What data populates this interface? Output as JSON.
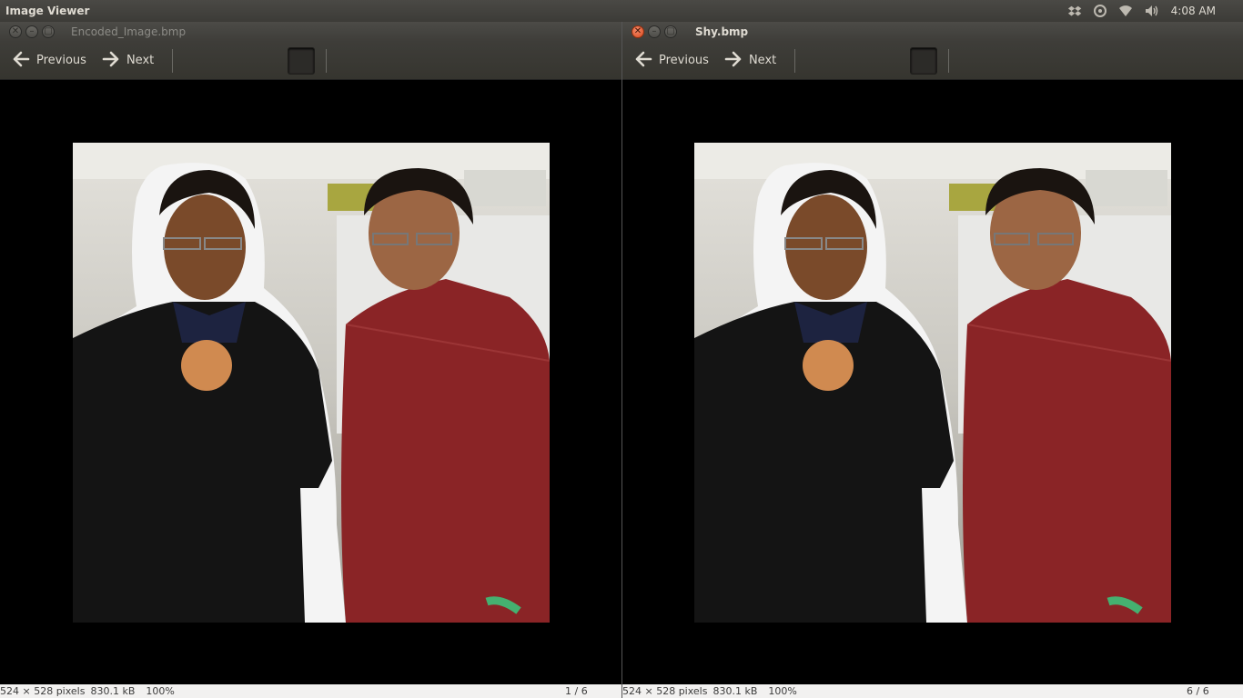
{
  "panel": {
    "app_title": "Image Viewer",
    "clock": "4:08 AM",
    "indicators": [
      "dropbox-icon",
      "sync-icon",
      "wifi-icon",
      "volume-icon"
    ]
  },
  "toolbar": {
    "previous_label": "Previous",
    "next_label": "Next",
    "icons": [
      "arrow-left-icon",
      "arrow-right-icon",
      "zoom-in-icon",
      "zoom-out-icon",
      "normal-size-icon",
      "best-fit-icon",
      "rotate-left-icon",
      "rotate-right-icon"
    ]
  },
  "windows": {
    "left": {
      "title": "Encoded_Image.bmp",
      "status_dims": "524 × 528 pixels",
      "status_size": "830.1 kB",
      "status_zoom": "100%",
      "status_position": "1 / 6"
    },
    "right": {
      "title": "Shy.bmp",
      "status_dims": "524 × 528 pixels",
      "status_size": "830.1 kB",
      "status_zoom": "100%",
      "status_position": "6 / 6"
    }
  },
  "colors": {
    "panel_bg": "#3c3b37",
    "close_button": "#e0522a",
    "statusbar_bg": "#f2f1f0",
    "viewport_bg": "#000000"
  }
}
